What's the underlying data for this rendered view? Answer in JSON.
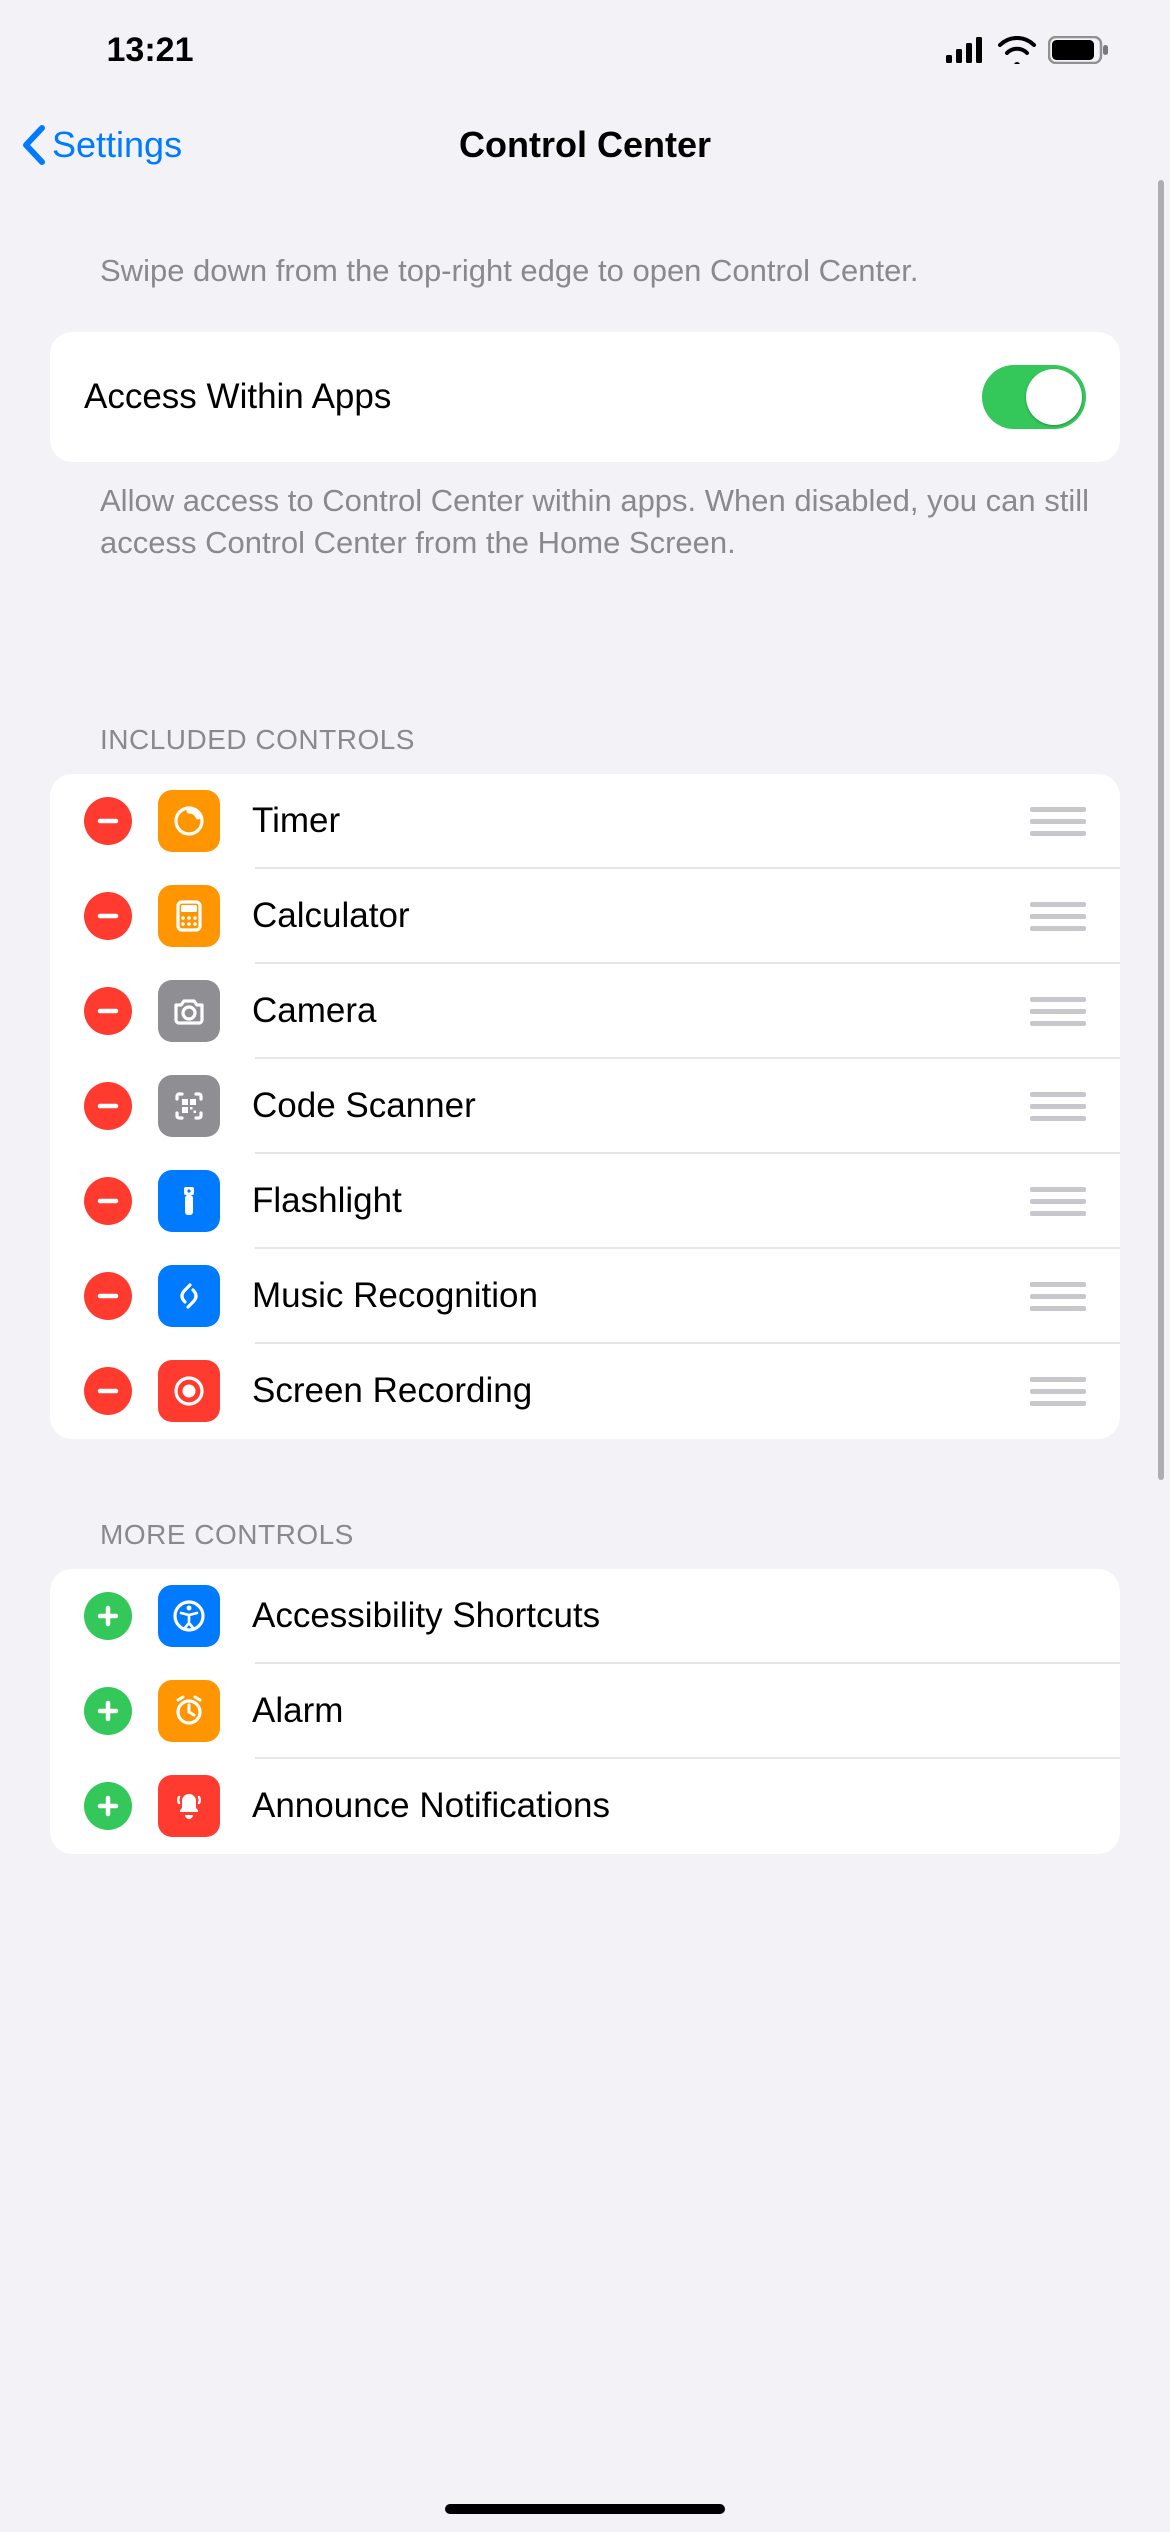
{
  "status": {
    "time": "13:21"
  },
  "nav": {
    "back": "Settings",
    "title": "Control Center"
  },
  "intro": "Swipe down from the top-right edge to open Control Center.",
  "access": {
    "label": "Access Within Apps",
    "on": true,
    "note": "Allow access to Control Center within apps. When disabled, you can still access Control Center from the Home Screen."
  },
  "included_header": "INCLUDED CONTROLS",
  "more_header": "MORE CONTROLS",
  "included": [
    {
      "label": "Timer",
      "icon": "timer",
      "color": "#ff9500"
    },
    {
      "label": "Calculator",
      "icon": "calc",
      "color": "#ff9500"
    },
    {
      "label": "Camera",
      "icon": "camera",
      "color": "#8e8e93"
    },
    {
      "label": "Code Scanner",
      "icon": "qr",
      "color": "#8e8e93"
    },
    {
      "label": "Flashlight",
      "icon": "flash",
      "color": "#007aff"
    },
    {
      "label": "Music Recognition",
      "icon": "shazam",
      "color": "#007aff"
    },
    {
      "label": "Screen Recording",
      "icon": "record",
      "color": "#ff3b30"
    }
  ],
  "more": [
    {
      "label": "Accessibility Shortcuts",
      "icon": "accessibility",
      "color": "#007aff"
    },
    {
      "label": "Alarm",
      "icon": "alarm",
      "color": "#ff9500"
    },
    {
      "label": "Announce Notifications",
      "icon": "announce",
      "color": "#ff3b30"
    }
  ]
}
